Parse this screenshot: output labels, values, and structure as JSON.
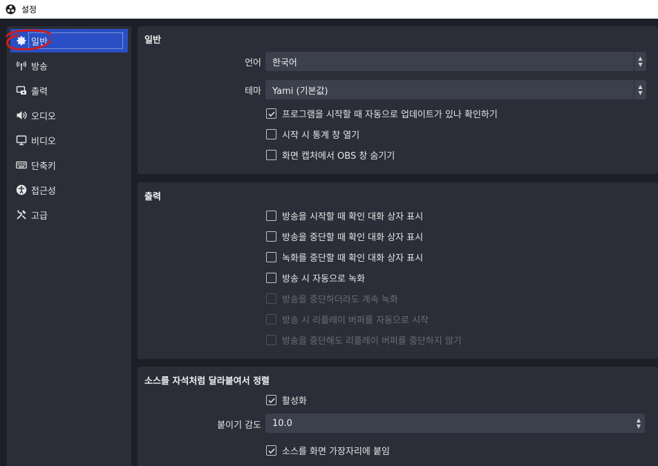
{
  "window": {
    "title": "설정",
    "app_icon": "obs-logo-icon"
  },
  "sidebar": {
    "items": [
      {
        "label": "일반",
        "icon": "gear-icon",
        "active": true
      },
      {
        "label": "방송",
        "icon": "broadcast-antenna-icon",
        "active": false
      },
      {
        "label": "출력",
        "icon": "output-icon",
        "active": false
      },
      {
        "label": "오디오",
        "icon": "speaker-icon",
        "active": false
      },
      {
        "label": "비디오",
        "icon": "monitor-icon",
        "active": false
      },
      {
        "label": "단축키",
        "icon": "keyboard-icon",
        "active": false
      },
      {
        "label": "접근성",
        "icon": "accessibility-icon",
        "active": false
      },
      {
        "label": "고급",
        "icon": "tools-icon",
        "active": false
      }
    ],
    "accent_color": "#2a4fc4",
    "annotation_color": "#d01e1e"
  },
  "general": {
    "title": "일반",
    "language_label": "언어",
    "language_value": "한국어",
    "theme_label": "테마",
    "theme_value": "Yami (기본값)",
    "checks": [
      {
        "label": "프로그램을 시작할 때 자동으로 업데이트가 있나 확인하기",
        "checked": true
      },
      {
        "label": "시작 시 통계 창 열기",
        "checked": false
      },
      {
        "label": "화면 캡처에서 OBS 창 숨기기",
        "checked": false
      }
    ]
  },
  "output": {
    "title": "출력",
    "checks": [
      {
        "label": "방송을 시작할 때 확인 대화 상자 표시",
        "checked": false,
        "enabled": true
      },
      {
        "label": "방송을 중단할 때 확인 대화 상자 표시",
        "checked": false,
        "enabled": true
      },
      {
        "label": "녹화를 중단할 때 확인 대화 상자 표시",
        "checked": false,
        "enabled": true
      },
      {
        "label": "방송 시 자동으로 녹화",
        "checked": false,
        "enabled": true
      },
      {
        "label": "방송을 중단하더라도 계속 녹화",
        "checked": false,
        "enabled": false
      },
      {
        "label": "방송 시 리플레이 버퍼를 자동으로 시작",
        "checked": false,
        "enabled": false
      },
      {
        "label": "방송을 중단해도 리플레이 버퍼를 중단하지 않기",
        "checked": false,
        "enabled": false
      }
    ]
  },
  "snapping": {
    "title": "소스를 자석처럼 달라붙여서 정렬",
    "enable_label": "활성화",
    "enable_checked": true,
    "sensitivity_label": "붙이기 감도",
    "sensitivity_value": "10.0",
    "snap_edges_label": "소스를 화면 가장자리에 붙임",
    "snap_edges_checked": true
  }
}
